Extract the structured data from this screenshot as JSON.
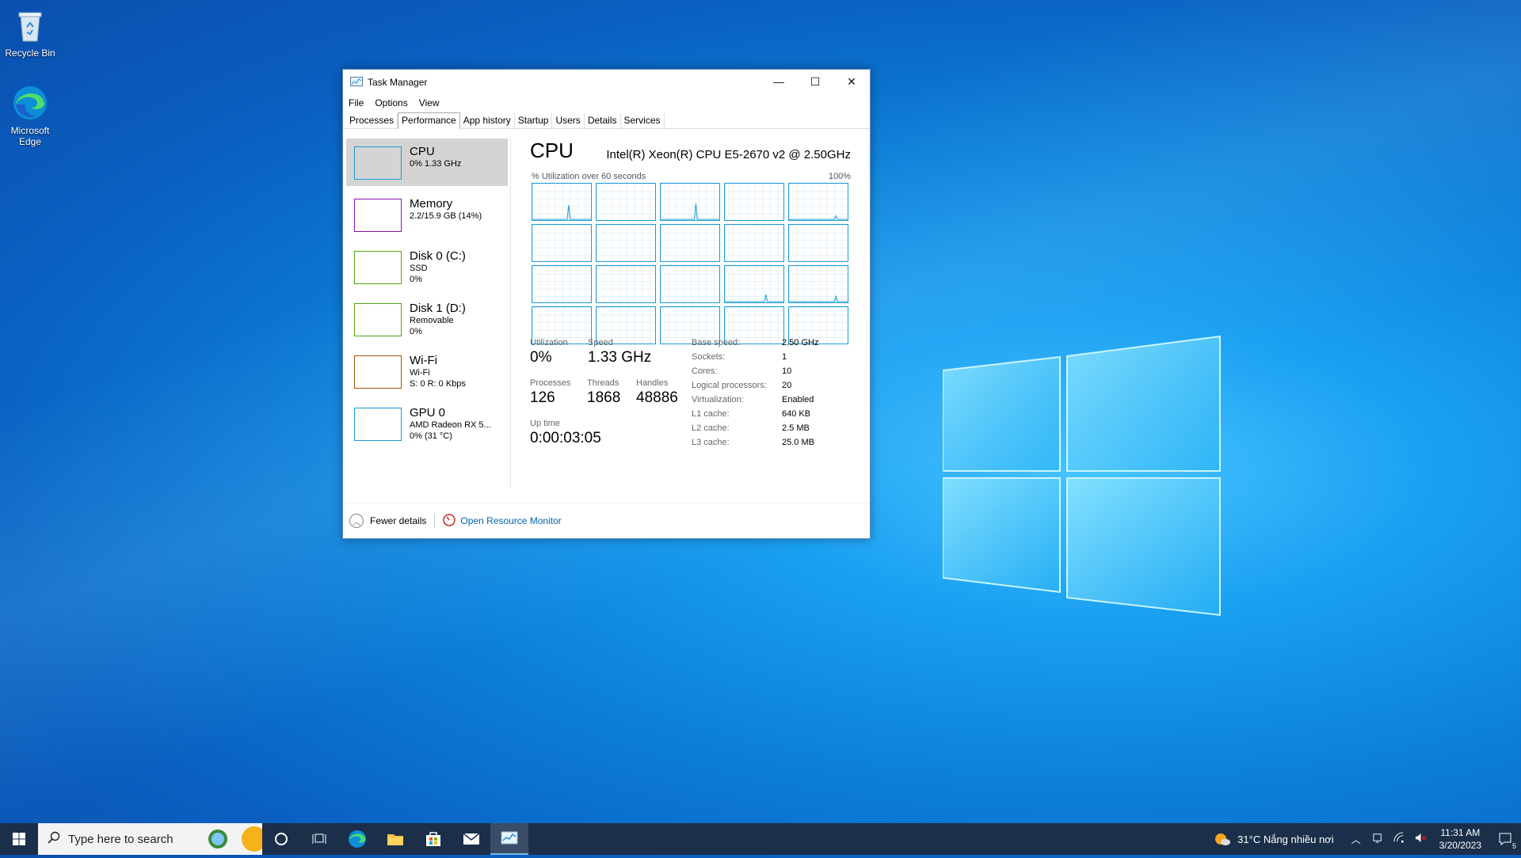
{
  "desktop": {
    "icons": [
      {
        "label": "Recycle Bin"
      },
      {
        "label": "Microsoft Edge"
      }
    ]
  },
  "window": {
    "title": "Task Manager",
    "controls": {
      "minimize": "—",
      "maximize": "☐",
      "close": "✕"
    },
    "menu": [
      "File",
      "Options",
      "View"
    ],
    "tabs": [
      "Processes",
      "Performance",
      "App history",
      "Startup",
      "Users",
      "Details",
      "Services"
    ],
    "active_tab": "Performance"
  },
  "devices": [
    {
      "name": "CPU",
      "line2": "0% 1.33 GHz",
      "line3": "",
      "color": "#1b9bd8"
    },
    {
      "name": "Memory",
      "line2": "2.2/15.9 GB (14%)",
      "line3": "",
      "color": "#8b12ae"
    },
    {
      "name": "Disk 0 (C:)",
      "line2": "SSD",
      "line3": "0%",
      "color": "#4da60c"
    },
    {
      "name": "Disk 1 (D:)",
      "line2": "Removable",
      "line3": "0%",
      "color": "#4da60c"
    },
    {
      "name": "Wi-Fi",
      "line2": "Wi-Fi",
      "line3": "S: 0 R: 0 Kbps",
      "color": "#a74f01"
    },
    {
      "name": "GPU 0",
      "line2": "AMD Radeon RX 5...",
      "line3": "0% (31 °C)",
      "color": "#1b9bd8"
    }
  ],
  "cpu": {
    "title": "CPU",
    "model": "Intel(R) Xeon(R) CPU E5-2670 v2 @ 2.50GHz",
    "util_label": "% Utilization over 60 seconds",
    "util_max": "100%",
    "utilization_label": "Utilization",
    "utilization": "0%",
    "speed_label": "Speed",
    "speed": "1.33 GHz",
    "processes_label": "Processes",
    "processes": "126",
    "threads_label": "Threads",
    "threads": "1868",
    "handles_label": "Handles",
    "handles": "48886",
    "uptime_label": "Up time",
    "uptime": "0:00:03:05",
    "specs": [
      {
        "k": "Base speed:",
        "v": "2.50 GHz"
      },
      {
        "k": "Sockets:",
        "v": "1"
      },
      {
        "k": "Cores:",
        "v": "10"
      },
      {
        "k": "Logical processors:",
        "v": "20"
      },
      {
        "k": "Virtualization:",
        "v": "Enabled"
      },
      {
        "k": "L1 cache:",
        "v": "640 KB"
      },
      {
        "k": "L2 cache:",
        "v": "2.5 MB"
      },
      {
        "k": "L3 cache:",
        "v": "25.0 MB"
      }
    ]
  },
  "footer": {
    "fewer": "Fewer details",
    "resmon": "Open Resource Monitor"
  },
  "taskbar": {
    "search_placeholder": "Type here to search",
    "weather": "31°C  Nắng nhiều nơi",
    "time": "11:31 AM",
    "date": "3/20/2023",
    "notif_count": "5"
  }
}
